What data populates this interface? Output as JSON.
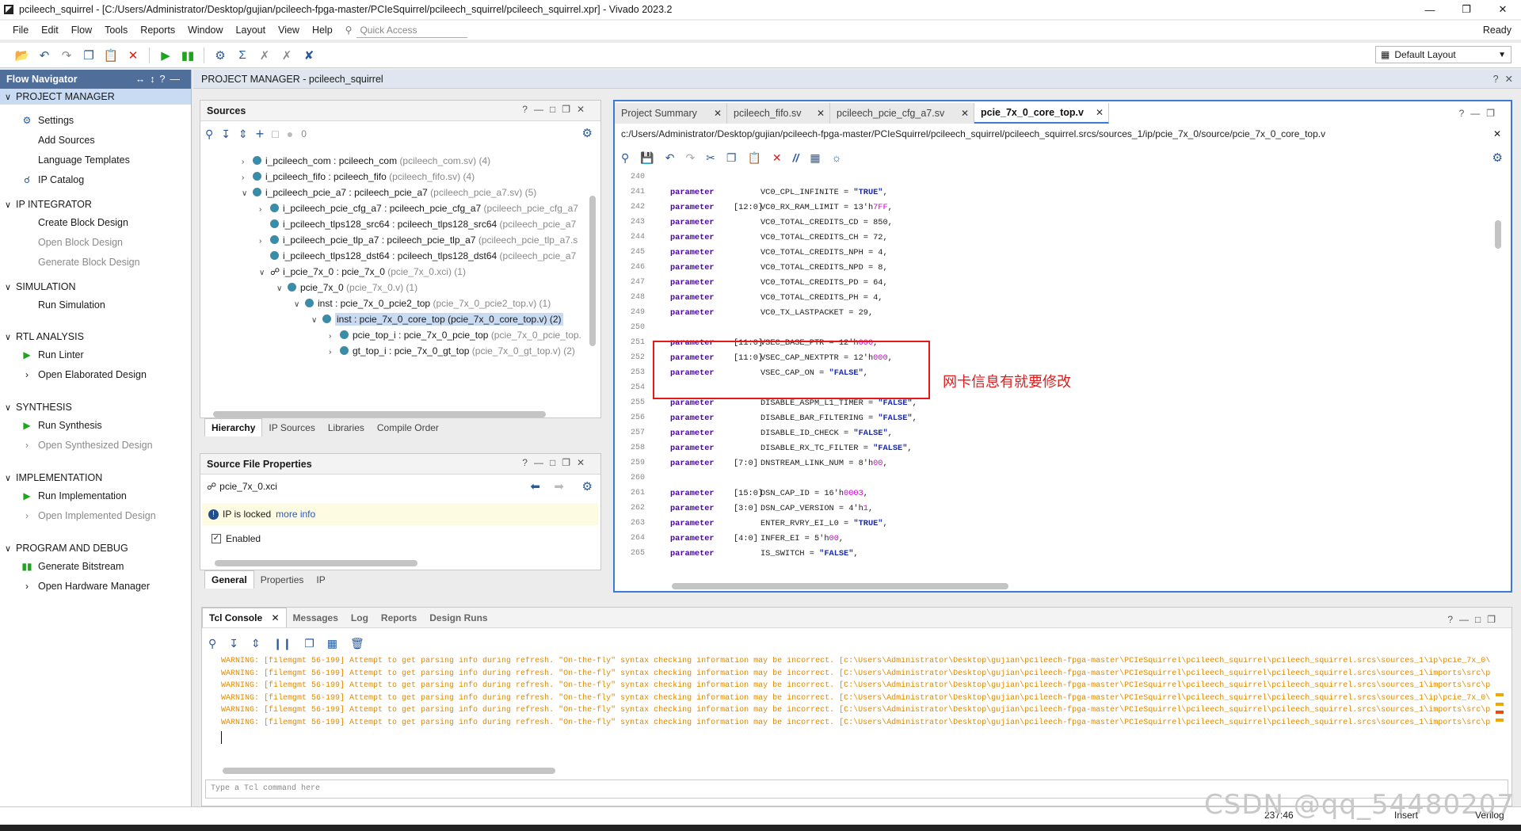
{
  "window": {
    "title": "pcileech_squirrel - [C:/Users/Administrator/Desktop/gujian/pcileech-fpga-master/PCIeSquirrel/pcileech_squirrel/pcileech_squirrel.xpr] - Vivado 2023.2",
    "status": "Ready"
  },
  "menu": [
    "File",
    "Edit",
    "Flow",
    "Tools",
    "Reports",
    "Window",
    "Layout",
    "View",
    "Help"
  ],
  "quick_access_placeholder": "Quick Access",
  "layout_selector": "Default Layout",
  "flow_nav": {
    "title": "Flow Navigator",
    "sections": [
      {
        "label": "PROJECT MANAGER",
        "items": [
          "Settings",
          "Add Sources",
          "Language Templates",
          "IP Catalog"
        ]
      },
      {
        "label": "IP INTEGRATOR",
        "items": [
          "Create Block Design",
          "Open Block Design",
          "Generate Block Design"
        ]
      },
      {
        "label": "SIMULATION",
        "items": [
          "Run Simulation"
        ]
      },
      {
        "label": "RTL ANALYSIS",
        "items": [
          "Run Linter",
          "Open Elaborated Design"
        ]
      },
      {
        "label": "SYNTHESIS",
        "items": [
          "Run Synthesis",
          "Open Synthesized Design"
        ]
      },
      {
        "label": "IMPLEMENTATION",
        "items": [
          "Run Implementation",
          "Open Implemented Design"
        ]
      },
      {
        "label": "PROGRAM AND DEBUG",
        "items": [
          "Generate Bitstream",
          "Open Hardware Manager"
        ]
      }
    ]
  },
  "pm_header": "PROJECT MANAGER - pcileech_squirrel",
  "sources": {
    "title": "Sources",
    "count": "0",
    "tree": [
      {
        "main": "i_pcileech_com : pcileech_com",
        "sub": "(pcileech_com.sv) (4)"
      },
      {
        "main": "i_pcileech_fifo : pcileech_fifo",
        "sub": "(pcileech_fifo.sv) (4)"
      },
      {
        "main": "i_pcileech_pcie_a7 : pcileech_pcie_a7",
        "sub": "(pcileech_pcie_a7.sv) (5)"
      },
      {
        "main": "i_pcileech_pcie_cfg_a7 : pcileech_pcie_cfg_a7",
        "sub": "(pcileech_pcie_cfg_a7"
      },
      {
        "main": "i_pcileech_tlps128_src64 : pcileech_tlps128_src64",
        "sub": "(pcileech_pcie_a7"
      },
      {
        "main": "i_pcileech_pcie_tlp_a7 : pcileech_pcie_tlp_a7",
        "sub": "(pcileech_pcie_tlp_a7.s"
      },
      {
        "main": "i_pcileech_tlps128_dst64 : pcileech_tlps128_dst64",
        "sub": "(pcileech_pcie_a7"
      },
      {
        "main": "i_pcie_7x_0 : pcie_7x_0",
        "sub": "(pcie_7x_0.xci) (1)"
      },
      {
        "main": "pcie_7x_0",
        "sub": "(pcie_7x_0.v) (1)"
      },
      {
        "main": "inst : pcie_7x_0_pcie2_top",
        "sub": "(pcie_7x_0_pcie2_top.v) (1)"
      },
      {
        "main": "inst : pcie_7x_0_core_top",
        "sub": "(pcie_7x_0_core_top.v) (2)"
      },
      {
        "main": "pcie_top_i : pcie_7x_0_pcie_top",
        "sub": "(pcie_7x_0_pcie_top."
      },
      {
        "main": "gt_top_i : pcie_7x_0_gt_top",
        "sub": "(pcie_7x_0_gt_top.v) (2)"
      }
    ],
    "tabs": [
      "Hierarchy",
      "IP Sources",
      "Libraries",
      "Compile Order"
    ]
  },
  "sfp": {
    "title": "Source File Properties",
    "file": "pcie_7x_0.xci",
    "locked": "IP is locked",
    "more": "more info",
    "enabled": "Enabled",
    "tabs": [
      "General",
      "Properties",
      "IP"
    ]
  },
  "editor": {
    "tabs": [
      "Project Summary",
      "pcileech_fifo.sv",
      "pcileech_pcie_cfg_a7.sv",
      "pcie_7x_0_core_top.v"
    ],
    "path": "c:/Users/Administrator/Desktop/gujian/pcileech-fpga-master/PCIeSquirrel/pcileech_squirrel/pcileech_squirrel.srcs/sources_1/ip/pcie_7x_0/source/pcie_7x_0_core_top.v",
    "note": "网卡信息有就要修改",
    "lines": [
      {
        "n": "240",
        "kw": "",
        "rng": "",
        "name": "",
        "val": "",
        "t": ""
      },
      {
        "n": "241",
        "kw": "parameter",
        "rng": "",
        "name": "VC0_CPL_INFINITE = ",
        "val": "\"TRUE\"",
        "t": "s"
      },
      {
        "n": "242",
        "kw": "parameter",
        "rng": "[12:0]",
        "name": "VC0_RX_RAM_LIMIT = 13'h",
        "val": "7FF",
        "t": "h"
      },
      {
        "n": "243",
        "kw": "parameter",
        "rng": "",
        "name": "VC0_TOTAL_CREDITS_CD = 850,",
        "val": "",
        "t": ""
      },
      {
        "n": "244",
        "kw": "parameter",
        "rng": "",
        "name": "VC0_TOTAL_CREDITS_CH = 72,",
        "val": "",
        "t": ""
      },
      {
        "n": "245",
        "kw": "parameter",
        "rng": "",
        "name": "VC0_TOTAL_CREDITS_NPH = 4,",
        "val": "",
        "t": ""
      },
      {
        "n": "246",
        "kw": "parameter",
        "rng": "",
        "name": "VC0_TOTAL_CREDITS_NPD = 8,",
        "val": "",
        "t": ""
      },
      {
        "n": "247",
        "kw": "parameter",
        "rng": "",
        "name": "VC0_TOTAL_CREDITS_PD = 64,",
        "val": "",
        "t": ""
      },
      {
        "n": "248",
        "kw": "parameter",
        "rng": "",
        "name": "VC0_TOTAL_CREDITS_PH = 4,",
        "val": "",
        "t": ""
      },
      {
        "n": "249",
        "kw": "parameter",
        "rng": "",
        "name": "VC0_TX_LASTPACKET = 29,",
        "val": "",
        "t": ""
      },
      {
        "n": "250",
        "kw": "",
        "rng": "",
        "name": "",
        "val": "",
        "t": ""
      },
      {
        "n": "251",
        "kw": "parameter",
        "rng": "[11:0]",
        "name": "VSEC_BASE_PTR = 12'h",
        "val": "000",
        "t": "h"
      },
      {
        "n": "252",
        "kw": "parameter",
        "rng": "[11:0]",
        "name": "VSEC_CAP_NEXTPTR = 12'h",
        "val": "000",
        "t": "h"
      },
      {
        "n": "253",
        "kw": "parameter",
        "rng": "",
        "name": "VSEC_CAP_ON = ",
        "val": "\"FALSE\"",
        "t": "s"
      },
      {
        "n": "254",
        "kw": "",
        "rng": "",
        "name": "",
        "val": "",
        "t": ""
      },
      {
        "n": "255",
        "kw": "parameter",
        "rng": "",
        "name": "DISABLE_ASPM_L1_TIMER = ",
        "val": "\"FALSE\"",
        "t": "s"
      },
      {
        "n": "256",
        "kw": "parameter",
        "rng": "",
        "name": "DISABLE_BAR_FILTERING = ",
        "val": "\"FALSE\"",
        "t": "s"
      },
      {
        "n": "257",
        "kw": "parameter",
        "rng": "",
        "name": "DISABLE_ID_CHECK = ",
        "val": "\"FALSE\"",
        "t": "s"
      },
      {
        "n": "258",
        "kw": "parameter",
        "rng": "",
        "name": "DISABLE_RX_TC_FILTER = ",
        "val": "\"FALSE\"",
        "t": "s"
      },
      {
        "n": "259",
        "kw": "parameter",
        "rng": "[7:0]",
        "name": "DNSTREAM_LINK_NUM = 8'h",
        "val": "00",
        "t": "h"
      },
      {
        "n": "260",
        "kw": "",
        "rng": "",
        "name": "",
        "val": "",
        "t": ""
      },
      {
        "n": "261",
        "kw": "parameter",
        "rng": "[15:0]",
        "name": "DSN_CAP_ID = 16'h",
        "val": "0003",
        "t": "h"
      },
      {
        "n": "262",
        "kw": "parameter",
        "rng": "[3:0]",
        "name": "DSN_CAP_VERSION = 4'h",
        "val": "1",
        "t": "h"
      },
      {
        "n": "263",
        "kw": "parameter",
        "rng": "",
        "name": "ENTER_RVRY_EI_L0 = ",
        "val": "\"TRUE\"",
        "t": "s"
      },
      {
        "n": "264",
        "kw": "parameter",
        "rng": "[4:0]",
        "name": "INFER_EI = 5'h",
        "val": "00",
        "t": "h"
      },
      {
        "n": "265",
        "kw": "parameter",
        "rng": "",
        "name": "IS_SWITCH = ",
        "val": "\"FALSE\"",
        "t": "s"
      }
    ]
  },
  "tcl": {
    "tabs": [
      "Tcl Console",
      "Messages",
      "Log",
      "Reports",
      "Design Runs"
    ],
    "warnings": [
      "WARNING: [filemgmt 56-199] Attempt to get parsing info during refresh. \"On-the-fly\" syntax checking information may be incorrect. [c:\\Users\\Administrator\\Desktop\\gujian\\pcileech-fpga-master\\PCIeSquirrel\\pcileech_squirrel\\pcileech_squirrel.srcs\\sources_1\\ip\\pcie_7x_0\\",
      "WARNING: [filemgmt 56-199] Attempt to get parsing info during refresh. \"On-the-fly\" syntax checking information may be incorrect. [C:\\Users\\Administrator\\Desktop\\gujian\\pcileech-fpga-master\\PCIeSquirrel\\pcileech_squirrel\\pcileech_squirrel.srcs\\sources_1\\imports\\src\\p",
      "WARNING: [filemgmt 56-199] Attempt to get parsing info during refresh. \"On-the-fly\" syntax checking information may be incorrect. [C:\\Users\\Administrator\\Desktop\\gujian\\pcileech-fpga-master\\PCIeSquirrel\\pcileech_squirrel\\pcileech_squirrel.srcs\\sources_1\\imports\\src\\p",
      "WARNING: [filemgmt 56-199] Attempt to get parsing info during refresh. \"On-the-fly\" syntax checking information may be incorrect. [C:\\Users\\Administrator\\Desktop\\gujian\\pcileech-fpga-master\\PCIeSquirrel\\pcileech_squirrel\\pcileech_squirrel.srcs\\sources_1\\ip\\pcie_7x_0\\",
      "WARNING: [filemgmt 56-199] Attempt to get parsing info during refresh. \"On-the-fly\" syntax checking information may be incorrect. [C:\\Users\\Administrator\\Desktop\\gujian\\pcileech-fpga-master\\PCIeSquirrel\\pcileech_squirrel\\pcileech_squirrel.srcs\\sources_1\\imports\\src\\p",
      "WARNING: [filemgmt 56-199] Attempt to get parsing info during refresh. \"On-the-fly\" syntax checking information may be incorrect. [C:\\Users\\Administrator\\Desktop\\gujian\\pcileech-fpga-master\\PCIeSquirrel\\pcileech_squirrel\\pcileech_squirrel.srcs\\sources_1\\imports\\src\\p"
    ],
    "placeholder": "Type a Tcl command here"
  },
  "statusbar": {
    "pos": "237:46",
    "mode": "Insert",
    "lang": "Verilog"
  },
  "watermark": "CSDN @qq_54480207"
}
